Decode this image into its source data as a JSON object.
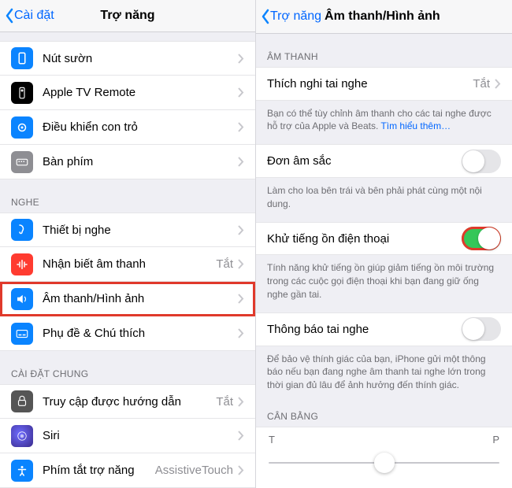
{
  "left": {
    "back": "Cài đặt",
    "title": "Trợ năng",
    "rows_top": [
      {
        "label": "Nút sườn",
        "icon_bg": "#0a84ff"
      },
      {
        "label": "Apple TV Remote",
        "icon_bg": "#000000"
      },
      {
        "label": "Điều khiển con trỏ",
        "icon_bg": "#0a84ff"
      },
      {
        "label": "Bàn phím",
        "icon_bg": "#8e8e93"
      }
    ],
    "section_listen": "NGHE",
    "rows_listen": [
      {
        "label": "Thiết bị nghe",
        "icon_bg": "#0a84ff",
        "value": ""
      },
      {
        "label": "Nhận biết âm thanh",
        "icon_bg": "#ff3b30",
        "value": "Tắt"
      },
      {
        "label": "Âm thanh/Hình ảnh",
        "icon_bg": "#0a84ff",
        "value": "",
        "highlight": true
      },
      {
        "label": "Phụ đề & Chú thích",
        "icon_bg": "#0a84ff",
        "value": ""
      }
    ],
    "section_general": "CÀI ĐẶT CHUNG",
    "rows_general": [
      {
        "label": "Truy cập được hướng dẫn",
        "icon_bg": "#555555",
        "value": "Tắt"
      },
      {
        "label": "Siri",
        "icon_bg": "#2b2f6b",
        "value": ""
      },
      {
        "label": "Phím tắt trợ năng",
        "icon_bg": "#0a84ff",
        "value": "AssistiveTouch"
      }
    ]
  },
  "right": {
    "back": "Trợ năng",
    "title": "Âm thanh/Hình ảnh",
    "section_audio": "ÂM THANH",
    "row_adapt": {
      "label": "Thích nghi tai nghe",
      "value": "Tắt"
    },
    "foot_adapt": {
      "text": "Bạn có thể tùy chỉnh âm thanh cho các tai nghe được hỗ trợ của Apple và Beats. ",
      "link": "Tìm hiểu thêm…"
    },
    "row_mono": {
      "label": "Đơn âm sắc",
      "on": false
    },
    "foot_mono": "Làm cho loa bên trái và bên phải phát cùng một nội dung.",
    "row_noise": {
      "label": "Khử tiếng ồn điện thoại",
      "on": true,
      "highlight": true
    },
    "foot_noise": "Tính năng khử tiếng ồn giúp giảm tiếng ồn môi trường trong các cuộc gọi điện thoại khi bạn đang giữ ống nghe gần tai.",
    "row_notif": {
      "label": "Thông báo tai nghe",
      "on": false
    },
    "foot_notif": "Để bảo vệ thính giác của bạn, iPhone gửi một thông báo nếu bạn đang nghe âm thanh tai nghe lớn trong thời gian đủ lâu để ảnh hưởng đến thính giác.",
    "section_balance": "CÂN BẰNG",
    "balance_left": "T",
    "balance_right": "P"
  }
}
